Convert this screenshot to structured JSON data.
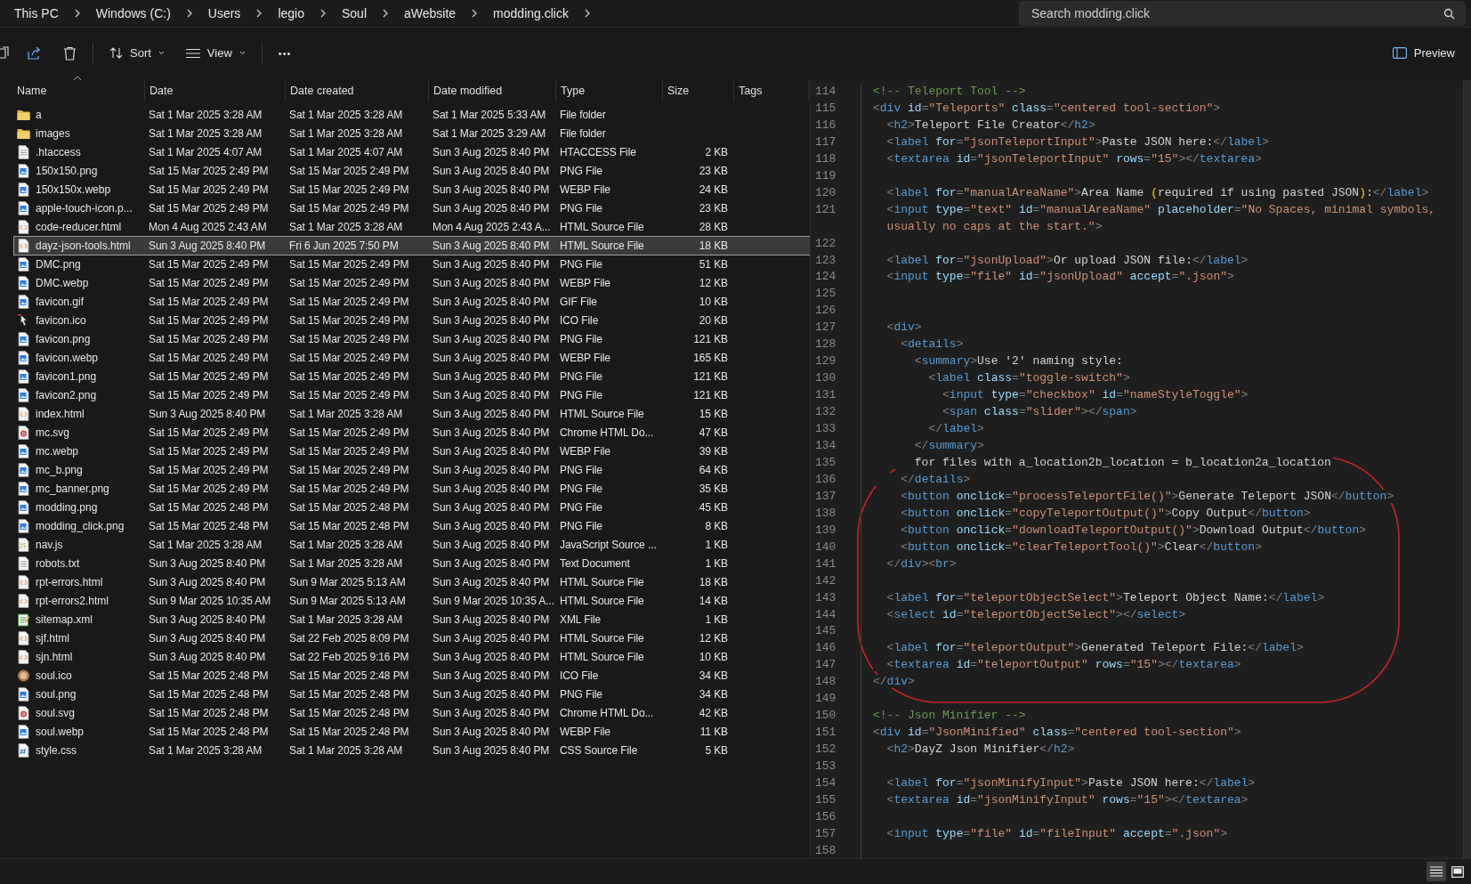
{
  "breadcrumb": [
    "This PC",
    "Windows (C:)",
    "Users",
    "legio",
    "Soul",
    "aWebsite",
    "modding.click"
  ],
  "search": {
    "placeholder": "Search modding.click"
  },
  "toolbar": {
    "sort": "Sort",
    "view": "View",
    "more": "•••",
    "preview": "Preview"
  },
  "columns": [
    "Name",
    "Date",
    "Date created",
    "Date modified",
    "Type",
    "Size",
    "Tags"
  ],
  "rows": [
    {
      "kind": "folder",
      "name": "a",
      "date": "Sat 1 Mar 2025 3:28 AM",
      "created": "Sat 1 Mar 2025 3:28 AM",
      "modified": "Sat 1 Mar 2025 5:33 AM",
      "type": "File folder",
      "selected": false
    },
    {
      "kind": "folder",
      "name": "images",
      "date": "Sat 1 Mar 2025 3:28 AM",
      "created": "Sat 1 Mar 2025 3:28 AM",
      "modified": "Sat 1 Mar 2025 3:29 AM",
      "type": "File folder",
      "selected": false
    },
    {
      "kind": "document",
      "name": ".htaccess",
      "date": "Sat 1 Mar 2025 4:07 AM",
      "created": "Sat 1 Mar 2025 4:07 AM",
      "modified": "Sun 3 Aug 2025 8:40 PM",
      "type": "HTACCESS File",
      "size": "2 KB",
      "selected": false
    },
    {
      "kind": "image",
      "name": "150x150.png",
      "date": "Sat 15 Mar 2025 2:49 PM",
      "created": "Sat 15 Mar 2025 2:49 PM",
      "modified": "Sun 3 Aug 2025 8:40 PM",
      "type": "PNG File",
      "size": "23 KB",
      "selected": false
    },
    {
      "kind": "image",
      "name": "150x150x.webp",
      "date": "Sat 15 Mar 2025 2:49 PM",
      "created": "Sat 15 Mar 2025 2:49 PM",
      "modified": "Sun 3 Aug 2025 8:40 PM",
      "type": "WEBP File",
      "size": "24 KB",
      "selected": false
    },
    {
      "kind": "image",
      "name": "apple-touch-icon.p...",
      "date": "Sat 15 Mar 2025 2:49 PM",
      "created": "Sat 15 Mar 2025 2:49 PM",
      "modified": "Sun 3 Aug 2025 8:40 PM",
      "type": "PNG File",
      "size": "23 KB",
      "selected": false
    },
    {
      "kind": "code",
      "name": "code-reducer.html",
      "date": "Mon 4 Aug 2025 2:43 AM",
      "created": "Sat 1 Mar 2025 3:28 AM",
      "modified": "Mon 4 Aug 2025 2:43 A...",
      "type": "HTML Source File",
      "size": "28 KB",
      "selected": false
    },
    {
      "kind": "code",
      "name": "dayz-json-tools.html",
      "date": "Sun 3 Aug 2025 8:40 PM",
      "created": "Fri 6 Jun 2025 7:50 PM",
      "modified": "Sun 3 Aug 2025 8:40 PM",
      "type": "HTML Source File",
      "size": "18 KB",
      "selected": true
    },
    {
      "kind": "image",
      "name": "DMC.png",
      "date": "Sat 15 Mar 2025 2:49 PM",
      "created": "Sat 15 Mar 2025 2:49 PM",
      "modified": "Sun 3 Aug 2025 8:40 PM",
      "type": "PNG File",
      "size": "51 KB",
      "selected": false
    },
    {
      "kind": "image",
      "name": "DMC.webp",
      "date": "Sat 15 Mar 2025 2:49 PM",
      "created": "Sat 15 Mar 2025 2:49 PM",
      "modified": "Sun 3 Aug 2025 8:40 PM",
      "type": "WEBP File",
      "size": "12 KB",
      "selected": false
    },
    {
      "kind": "image",
      "name": "favicon.gif",
      "date": "Sat 15 Mar 2025 2:49 PM",
      "created": "Sat 15 Mar 2025 2:49 PM",
      "modified": "Sun 3 Aug 2025 8:40 PM",
      "type": "GIF File",
      "size": "10 KB",
      "selected": false
    },
    {
      "kind": "ico",
      "name": "favicon.ico",
      "date": "Sat 15 Mar 2025 2:49 PM",
      "created": "Sat 15 Mar 2025 2:49 PM",
      "modified": "Sun 3 Aug 2025 8:40 PM",
      "type": "ICO File",
      "size": "20 KB",
      "selected": false
    },
    {
      "kind": "image",
      "name": "favicon.png",
      "date": "Sat 15 Mar 2025 2:49 PM",
      "created": "Sat 15 Mar 2025 2:49 PM",
      "modified": "Sun 3 Aug 2025 8:40 PM",
      "type": "PNG File",
      "size": "121 KB",
      "selected": false
    },
    {
      "kind": "image",
      "name": "favicon.webp",
      "date": "Sat 15 Mar 2025 2:49 PM",
      "created": "Sat 15 Mar 2025 2:49 PM",
      "modified": "Sun 3 Aug 2025 8:40 PM",
      "type": "WEBP File",
      "size": "165 KB",
      "selected": false
    },
    {
      "kind": "image",
      "name": "favicon1.png",
      "date": "Sat 15 Mar 2025 2:49 PM",
      "created": "Sat 15 Mar 2025 2:49 PM",
      "modified": "Sun 3 Aug 2025 8:40 PM",
      "type": "PNG File",
      "size": "121 KB",
      "selected": false
    },
    {
      "kind": "image",
      "name": "favicon2.png",
      "date": "Sat 15 Mar 2025 2:49 PM",
      "created": "Sat 15 Mar 2025 2:49 PM",
      "modified": "Sun 3 Aug 2025 8:40 PM",
      "type": "PNG File",
      "size": "121 KB",
      "selected": false
    },
    {
      "kind": "code",
      "name": "index.html",
      "date": "Sun 3 Aug 2025 8:40 PM",
      "created": "Sat 1 Mar 2025 3:28 AM",
      "modified": "Sun 3 Aug 2025 8:40 PM",
      "type": "HTML Source File",
      "size": "15 KB",
      "selected": false
    },
    {
      "kind": "browser",
      "name": "mc.svg",
      "date": "Sat 15 Mar 2025 2:49 PM",
      "created": "Sat 15 Mar 2025 2:49 PM",
      "modified": "Sun 3 Aug 2025 8:40 PM",
      "type": "Chrome HTML Do...",
      "size": "47 KB",
      "selected": false
    },
    {
      "kind": "image",
      "name": "mc.webp",
      "date": "Sat 15 Mar 2025 2:49 PM",
      "created": "Sat 15 Mar 2025 2:49 PM",
      "modified": "Sun 3 Aug 2025 8:40 PM",
      "type": "WEBP File",
      "size": "39 KB",
      "selected": false
    },
    {
      "kind": "image",
      "name": "mc_b.png",
      "date": "Sat 15 Mar 2025 2:49 PM",
      "created": "Sat 15 Mar 2025 2:49 PM",
      "modified": "Sun 3 Aug 2025 8:40 PM",
      "type": "PNG File",
      "size": "64 KB",
      "selected": false
    },
    {
      "kind": "image",
      "name": "mc_banner.png",
      "date": "Sat 15 Mar 2025 2:49 PM",
      "created": "Sat 15 Mar 2025 2:49 PM",
      "modified": "Sun 3 Aug 2025 8:40 PM",
      "type": "PNG File",
      "size": "35 KB",
      "selected": false
    },
    {
      "kind": "image",
      "name": "modding.png",
      "date": "Sat 15 Mar 2025 2:48 PM",
      "created": "Sat 15 Mar 2025 2:48 PM",
      "modified": "Sun 3 Aug 2025 8:40 PM",
      "type": "PNG File",
      "size": "45 KB",
      "selected": false
    },
    {
      "kind": "image",
      "name": "modding_click.png",
      "date": "Sat 15 Mar 2025 2:48 PM",
      "created": "Sat 15 Mar 2025 2:48 PM",
      "modified": "Sun 3 Aug 2025 8:40 PM",
      "type": "PNG File",
      "size": "8 KB",
      "selected": false
    },
    {
      "kind": "script",
      "name": "nav.js",
      "date": "Sat 1 Mar 2025 3:28 AM",
      "created": "Sat 1 Mar 2025 3:28 AM",
      "modified": "Sun 3 Aug 2025 8:40 PM",
      "type": "JavaScript Source ...",
      "size": "1 KB",
      "selected": false
    },
    {
      "kind": "document",
      "name": "robots.txt",
      "date": "Sun 3 Aug 2025 8:40 PM",
      "created": "Sat 1 Mar 2025 3:28 AM",
      "modified": "Sun 3 Aug 2025 8:40 PM",
      "type": "Text Document",
      "size": "1 KB",
      "selected": false
    },
    {
      "kind": "code",
      "name": "rpt-errors.html",
      "date": "Sun 3 Aug 2025 8:40 PM",
      "created": "Sun 9 Mar 2025 5:13 AM",
      "modified": "Sun 3 Aug 2025 8:40 PM",
      "type": "HTML Source File",
      "size": "18 KB",
      "selected": false
    },
    {
      "kind": "code",
      "name": "rpt-errors2.html",
      "date": "Sun 9 Mar 2025 10:35 AM",
      "created": "Sun 9 Mar 2025 5:13 AM",
      "modified": "Sun 9 Mar 2025 10:35 A...",
      "type": "HTML Source File",
      "size": "14 KB",
      "selected": false
    },
    {
      "kind": "xml",
      "name": "sitemap.xml",
      "date": "Sun 3 Aug 2025 8:40 PM",
      "created": "Sat 1 Mar 2025 3:28 AM",
      "modified": "Sun 3 Aug 2025 8:40 PM",
      "type": "XML File",
      "size": "1 KB",
      "selected": false
    },
    {
      "kind": "code",
      "name": "sjf.html",
      "date": "Sun 3 Aug 2025 8:40 PM",
      "created": "Sat 22 Feb 2025 8:09 PM",
      "modified": "Sun 3 Aug 2025 8:40 PM",
      "type": "HTML Source File",
      "size": "12 KB",
      "selected": false
    },
    {
      "kind": "code",
      "name": "sjn.html",
      "date": "Sun 3 Aug 2025 8:40 PM",
      "created": "Sat 22 Feb 2025 9:16 PM",
      "modified": "Sun 3 Aug 2025 8:40 PM",
      "type": "HTML Source File",
      "size": "10 KB",
      "selected": false
    },
    {
      "kind": "avatar",
      "name": "soul.ico",
      "date": "Sat 15 Mar 2025 2:48 PM",
      "created": "Sat 15 Mar 2025 2:48 PM",
      "modified": "Sun 3 Aug 2025 8:40 PM",
      "type": "ICO File",
      "size": "34 KB",
      "selected": false
    },
    {
      "kind": "image",
      "name": "soul.png",
      "date": "Sat 15 Mar 2025 2:48 PM",
      "created": "Sat 15 Mar 2025 2:48 PM",
      "modified": "Sun 3 Aug 2025 8:40 PM",
      "type": "PNG File",
      "size": "34 KB",
      "selected": false
    },
    {
      "kind": "browser",
      "name": "soul.svg",
      "date": "Sat 15 Mar 2025 2:48 PM",
      "created": "Sat 15 Mar 2025 2:48 PM",
      "modified": "Sun 3 Aug 2025 8:40 PM",
      "type": "Chrome HTML Do...",
      "size": "42 KB",
      "selected": false
    },
    {
      "kind": "image",
      "name": "soul.webp",
      "date": "Sat 15 Mar 2025 2:48 PM",
      "created": "Sat 15 Mar 2025 2:48 PM",
      "modified": "Sun 3 Aug 2025 8:40 PM",
      "type": "WEBP File",
      "size": "11 KB",
      "selected": false
    },
    {
      "kind": "stylesheet",
      "name": "style.css",
      "date": "Sat 1 Mar 2025 3:28 AM",
      "created": "Sat 1 Mar 2025 3:28 AM",
      "modified": "Sun 3 Aug 2025 8:40 PM",
      "type": "CSS Source File",
      "size": "5 KB",
      "selected": false
    }
  ],
  "code": [
    {
      "number": "114",
      "text": "<!-- Teleport Tool -->"
    },
    {
      "number": "115",
      "text": "<div id=\"Teleports\" class=\"centered tool-section\">"
    },
    {
      "number": "116",
      "text": "  <h2>Teleport File Creator</h2>"
    },
    {
      "number": "117",
      "text": "  <label for=\"jsonTeleportInput\">Paste JSON here:</label>"
    },
    {
      "number": "118",
      "text": "  <textarea id=\"jsonTeleportInput\" rows=\"15\"></textarea>"
    },
    {
      "number": "119"
    },
    {
      "number": "120",
      "text": "  <label for=\"manualAreaName\">Area Name (required if using pasted JSON):</label>"
    },
    {
      "number": "121",
      "text": "  <input type=\"text\" id=\"manualAreaName\" placeholder=\"No Spaces, minimal symbols,"
    },
    {
      "text": "  usually no caps at the start.\">"
    },
    {
      "number": "122"
    },
    {
      "number": "123",
      "text": "  <label for=\"jsonUpload\">Or upload JSON file:</label>"
    },
    {
      "number": "124",
      "text": "  <input type=\"file\" id=\"jsonUpload\" accept=\".json\">"
    },
    {
      "number": "125"
    },
    {
      "number": "126"
    },
    {
      "number": "127",
      "text": "  <div>"
    },
    {
      "number": "128",
      "text": "    <details>"
    },
    {
      "number": "129",
      "text": "      <summary>Use '2' naming style:"
    },
    {
      "number": "130",
      "text": "        <label class=\"toggle-switch\">"
    },
    {
      "number": "131",
      "text": "          <input type=\"checkbox\" id=\"nameStyleToggle\">"
    },
    {
      "number": "132",
      "text": "          <span class=\"slider\"></span>"
    },
    {
      "number": "133",
      "text": "        </label>"
    },
    {
      "number": "134",
      "text": "      </summary>"
    },
    {
      "number": "135",
      "text": "      for files with a_location2b_location = b_location2a_location"
    },
    {
      "number": "136",
      "text": "    </details>"
    },
    {
      "number": "137",
      "text": "    <button onclick=\"processTeleportFile()\">Generate Teleport JSON</button>"
    },
    {
      "number": "138",
      "text": "    <button onclick=\"copyTeleportOutput()\">Copy Output</button>"
    },
    {
      "number": "139",
      "text": "    <button onclick=\"downloadTeleportOutput()\">Download Output</button>"
    },
    {
      "number": "140",
      "text": "    <button onclick=\"clearTeleportTool()\">Clear</button>"
    },
    {
      "number": "141",
      "text": "  </div><br>"
    },
    {
      "number": "142"
    },
    {
      "number": "143",
      "text": "  <label for=\"teleportObjectSelect\">Teleport Object Name:</label>"
    },
    {
      "number": "144",
      "text": "  <select id=\"teleportObjectSelect\"></select>"
    },
    {
      "number": "145"
    },
    {
      "number": "146",
      "text": "  <label for=\"teleportOutput\">Generated Teleport File:</label>"
    },
    {
      "number": "147",
      "text": "  <textarea id=\"teleportOutput\" rows=\"15\"></textarea>"
    },
    {
      "number": "148",
      "text": "</div>"
    },
    {
      "number": "149"
    },
    {
      "number": "150",
      "text": "<!-- Json Minifier -->"
    },
    {
      "number": "151",
      "text": "<div id=\"JsonMinified\" class=\"centered tool-section\">"
    },
    {
      "number": "152",
      "text": "  <h2>DayZ Json Minifier</h2>"
    },
    {
      "number": "153"
    },
    {
      "number": "154",
      "text": "  <label for=\"jsonMinifyInput\">Paste JSON here:</label>"
    },
    {
      "number": "155",
      "text": "  <textarea id=\"jsonMinifyInput\" rows=\"15\"></textarea>"
    },
    {
      "number": "156"
    },
    {
      "number": "157",
      "text": "  <input type=\"file\" id=\"fileInput\" accept=\".json\">"
    },
    {
      "number": "158"
    }
  ]
}
